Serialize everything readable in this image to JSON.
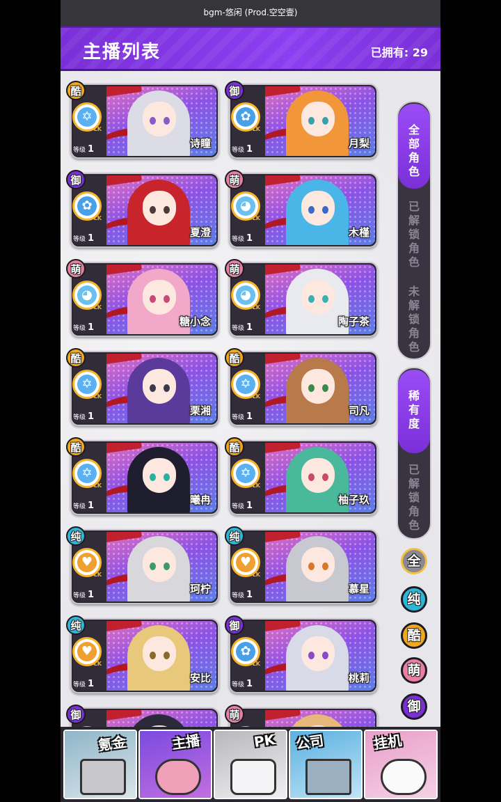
{
  "topbar": {
    "title": "bgm-悠闲 (Prod.空空壹)"
  },
  "header": {
    "title": "主播列表",
    "owned": "已拥有: 29"
  },
  "colors": {
    "purple": "#8b3ff0",
    "badge_cool": "#f0a81c",
    "badge_royal": "#7a2fd8",
    "badge_cute": "#e87fa0",
    "badge_pure": "#29b8d8"
  },
  "level_label": "等级",
  "cards": [
    {
      "badge": "酷",
      "name": "诗瞳",
      "level": "1",
      "emblem": "star-icon",
      "hair": "#dcdce6",
      "eye": "#8a5ac8"
    },
    {
      "badge": "御",
      "name": "月梨",
      "level": "1",
      "emblem": "rose-icon",
      "hair": "#f2963a",
      "eye": "#3aa0a8"
    },
    {
      "badge": "御",
      "name": "夏澄",
      "level": "1",
      "emblem": "rose-icon",
      "hair": "#c8242c",
      "eye": "#4a3a3a"
    },
    {
      "badge": "萌",
      "name": "木槿",
      "level": "1",
      "emblem": "cat-icon",
      "hair": "#4ab6e8",
      "eye": "#3a6ac8"
    },
    {
      "badge": "萌",
      "name": "糖小念",
      "level": "1",
      "emblem": "cat-icon",
      "hair": "#f2a8c8",
      "eye": "#c8487a"
    },
    {
      "badge": "萌",
      "name": "陶子茶",
      "level": "1",
      "emblem": "cat-icon",
      "hair": "#e8eaf0",
      "eye": "#3ab0b0"
    },
    {
      "badge": "酷",
      "name": "栗湘",
      "level": "1",
      "emblem": "star-icon",
      "hair": "#5a3a9a",
      "eye": "#3a3a4a"
    },
    {
      "badge": "酷",
      "name": "司凡",
      "level": "1",
      "emblem": "star-icon",
      "hair": "#b87a4a",
      "eye": "#3a8a4a"
    },
    {
      "badge": "酷",
      "name": "曦冉",
      "level": "1",
      "emblem": "star-icon",
      "hair": "#1e1e2e",
      "eye": "#2ab0a0"
    },
    {
      "badge": "酷",
      "name": "柚子玖",
      "level": "1",
      "emblem": "star-icon",
      "hair": "#4ab89a",
      "eye": "#c84a6a"
    },
    {
      "badge": "纯",
      "name": "珂柠",
      "level": "1",
      "emblem": "heart-icon",
      "hair": "#d8d8dc",
      "eye": "#3a9a6a"
    },
    {
      "badge": "纯",
      "name": "慕星",
      "level": "1",
      "emblem": "heart-icon",
      "hair": "#c8c8d0",
      "eye": "#d8762a"
    },
    {
      "badge": "纯",
      "name": "安比",
      "level": "1",
      "emblem": "heart-icon",
      "hair": "#e8c87a",
      "eye": "#8a6a2a"
    },
    {
      "badge": "御",
      "name": "桃莉",
      "level": "1",
      "emblem": "rose-icon",
      "hair": "#d8dae8",
      "eye": "#8a4ac8"
    },
    {
      "badge": "御",
      "name": "",
      "level": "",
      "emblem": "rose-icon",
      "hair": "#2a2a3a",
      "eye": "#3a3a4a"
    },
    {
      "badge": "萌",
      "name": "",
      "level": "",
      "emblem": "cat-icon",
      "hair": "#e8b87a",
      "eye": "#3a3a4a"
    }
  ],
  "sidebar": {
    "group1": [
      "全部角色",
      "已解锁角色",
      "未解锁角色"
    ],
    "group2": [
      "稀有度",
      "已解锁角色"
    ]
  },
  "filters": [
    "全",
    "纯",
    "酷",
    "萌",
    "御"
  ],
  "nav": [
    {
      "label": "氪金",
      "icon": "coins-icon"
    },
    {
      "label": "主播",
      "icon": "streamer-icon"
    },
    {
      "label": "PK",
      "icon": "pk-icon"
    },
    {
      "label": "公司",
      "icon": "building-icon"
    },
    {
      "label": "挂机",
      "icon": "piggy-bank-icon"
    }
  ]
}
